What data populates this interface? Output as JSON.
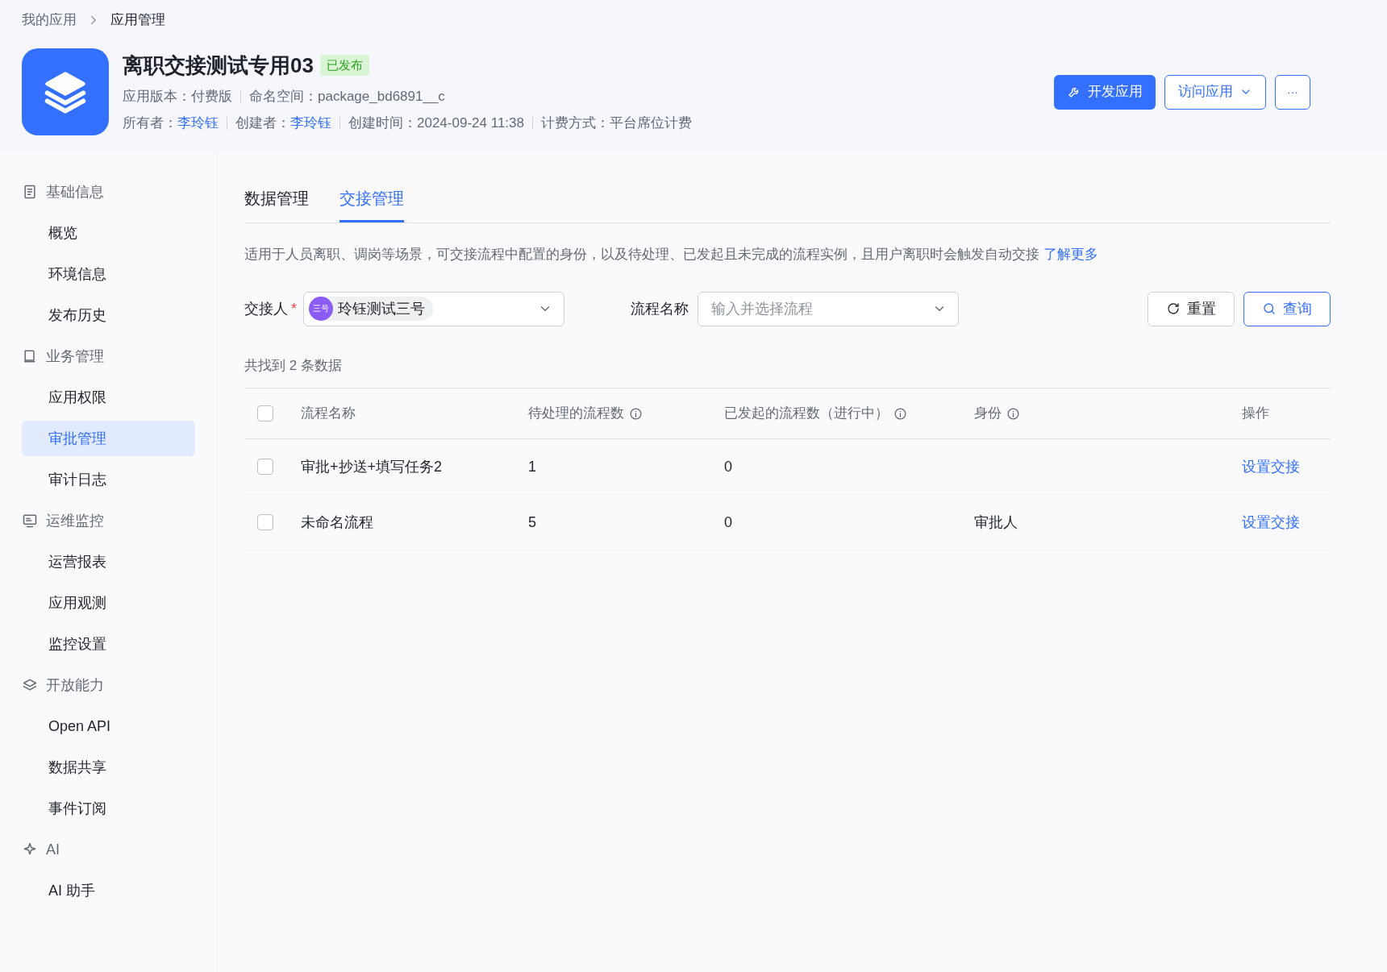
{
  "breadcrumb": [
    "我的应用",
    "应用管理"
  ],
  "app": {
    "title": "离职交接测试专用03",
    "status": "已发布",
    "meta_line_1": [
      {
        "label": "应用版本：",
        "value": "付费版",
        "link": false
      },
      {
        "label": "命名空间：",
        "value": "package_bd6891__c",
        "link": false
      }
    ],
    "meta_line_2": [
      {
        "label": "所有者：",
        "value": "李玲钰",
        "link": true
      },
      {
        "label": "创建者：",
        "value": "李玲钰",
        "link": true
      },
      {
        "label": "创建时间：",
        "value": "2024-09-24 11:38",
        "link": false
      },
      {
        "label": "计费方式：",
        "value": "平台席位计费",
        "link": false
      }
    ]
  },
  "actions": [
    {
      "kind": "primary",
      "label": "开发应用"
    },
    {
      "kind": "dropdown",
      "label": "访问应用"
    },
    {
      "kind": "more",
      "label": "···"
    }
  ],
  "sidebar": [
    {
      "kind": "section",
      "label": "基础信息"
    },
    {
      "kind": "item",
      "label": "概览",
      "selected": false
    },
    {
      "kind": "item",
      "label": "环境信息",
      "selected": false
    },
    {
      "kind": "item",
      "label": "发布历史",
      "selected": false
    },
    {
      "kind": "section",
      "label": "业务管理"
    },
    {
      "kind": "item",
      "label": "应用权限",
      "selected": false
    },
    {
      "kind": "item",
      "label": "审批管理",
      "selected": true
    },
    {
      "kind": "item",
      "label": "审计日志",
      "selected": false
    },
    {
      "kind": "section",
      "label": "运维监控"
    },
    {
      "kind": "item",
      "label": "运营报表",
      "selected": false
    },
    {
      "kind": "item",
      "label": "应用观测",
      "selected": false
    },
    {
      "kind": "item",
      "label": "监控设置",
      "selected": false
    },
    {
      "kind": "section",
      "label": "开放能力"
    },
    {
      "kind": "item",
      "label": "Open API",
      "selected": false
    },
    {
      "kind": "item",
      "label": "数据共享",
      "selected": false
    },
    {
      "kind": "item",
      "label": "事件订阅",
      "selected": false
    },
    {
      "kind": "section",
      "label": "AI"
    },
    {
      "kind": "item",
      "label": "AI 助手",
      "selected": false
    }
  ],
  "tabs": [
    {
      "label": "数据管理",
      "selected": false
    },
    {
      "label": "交接管理",
      "selected": true
    }
  ],
  "description": {
    "text": "适用于人员离职、调岗等场景，可交接流程中配置的身份，以及待处理、已发起且未完成的流程实例，且用户离职时会触发自动交接",
    "link": "了解更多"
  },
  "filters": {
    "assignee": {
      "label": "交接人",
      "required_mark": "*",
      "avatar_text": "三号",
      "value": "玲钰测试三号"
    },
    "process": {
      "label": "流程名称",
      "placeholder": "输入并选择流程"
    },
    "reset": "重置",
    "query": "查询"
  },
  "result_count": "共找到 2 条数据",
  "table": {
    "all_checked": false,
    "columns": [
      {
        "label": "流程名称",
        "info": false
      },
      {
        "label": "待处理的流程数",
        "info": true
      },
      {
        "label": "已发起的流程数（进行中）",
        "info": true
      },
      {
        "label": "身份",
        "info": true
      },
      {
        "label": "操作",
        "info": false
      }
    ],
    "rows": [
      {
        "checked": false,
        "name": "审批+抄送+填写任务2",
        "pending": "1",
        "started": "0",
        "role": "",
        "action": "设置交接"
      },
      {
        "checked": false,
        "name": "未命名流程",
        "pending": "5",
        "started": "0",
        "role": "审批人",
        "action": "设置交接"
      }
    ]
  }
}
